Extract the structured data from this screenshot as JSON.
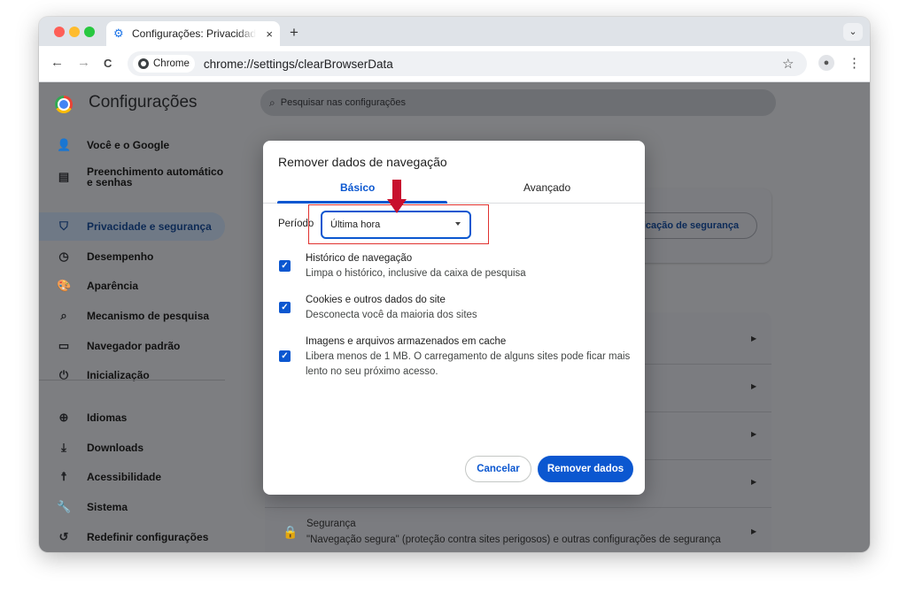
{
  "window": {
    "tab_title": "Configurações: Privacidade e segurança",
    "tab_close": "×",
    "new_tab": "+",
    "tab_dropdown": "⌄"
  },
  "toolbar": {
    "back": "←",
    "forward": "→",
    "reload": "C",
    "site_chip": "Chrome",
    "url": "chrome://settings/clearBrowserData",
    "bookmark": "☆",
    "menu": "⋮"
  },
  "settings": {
    "title": "Configurações",
    "search_placeholder": "Pesquisar nas configurações",
    "sidebar": [
      {
        "label": "Você e o Google",
        "icon": "person-icon",
        "glyph": "👤"
      },
      {
        "label": "Preenchimento automático e senhas",
        "icon": "clipboard-icon",
        "glyph": "▤"
      },
      {
        "label": "Privacidade e segurança",
        "icon": "shield-icon",
        "glyph": "⛉"
      },
      {
        "label": "Desempenho",
        "icon": "speedometer-icon",
        "glyph": "◷"
      },
      {
        "label": "Aparência",
        "icon": "palette-icon",
        "glyph": "🎨"
      },
      {
        "label": "Mecanismo de pesquisa",
        "icon": "search-icon",
        "glyph": "⌕"
      },
      {
        "label": "Navegador padrão",
        "icon": "browser-icon",
        "glyph": "▭"
      },
      {
        "label": "Inicialização",
        "icon": "power-icon",
        "glyph": "⏻"
      },
      {
        "label": "Idiomas",
        "icon": "globe-icon",
        "glyph": "⊕"
      },
      {
        "label": "Downloads",
        "icon": "download-icon",
        "glyph": "⤓"
      },
      {
        "label": "Acessibilidade",
        "icon": "accessibility-icon",
        "glyph": "☨"
      },
      {
        "label": "Sistema",
        "icon": "wrench-icon",
        "glyph": "🔧"
      },
      {
        "label": "Redefinir configurações",
        "icon": "reset-icon",
        "glyph": "↺"
      }
    ],
    "safety_check_button": "Verificação de segurança",
    "security_row": {
      "title": "Segurança",
      "subtitle": "\"Navegação segura\" (proteção contra sites perigosos) e outras configurações de segurança"
    }
  },
  "dialog": {
    "title": "Remover dados de navegação",
    "tabs": [
      "Básico",
      "Avançado"
    ],
    "period_label": "Período",
    "period_value": "Última hora",
    "options": [
      {
        "title": "Histórico de navegação",
        "subtitle": "Limpa o histórico, inclusive da caixa de pesquisa",
        "checked": true
      },
      {
        "title": "Cookies e outros dados do site",
        "subtitle": "Desconecta você da maioria dos sites",
        "checked": true
      },
      {
        "title": "Imagens e arquivos armazenados em cache",
        "subtitle": "Libera menos de 1 MB. O carregamento de alguns sites pode ficar mais lento no seu próximo acesso.",
        "checked": true
      }
    ],
    "cancel": "Cancelar",
    "remove": "Remover dados",
    "check_glyph": "✓"
  },
  "colors": {
    "accent": "#0b57d0",
    "annotation_red": "#e0322f"
  }
}
